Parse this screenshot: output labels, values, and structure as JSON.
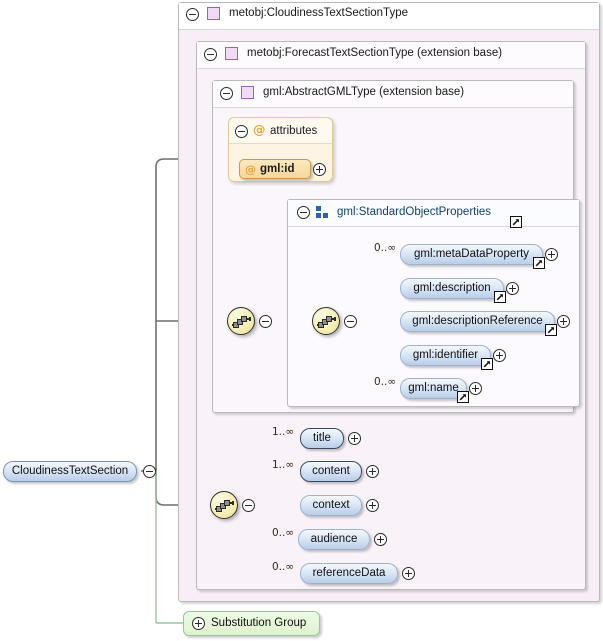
{
  "diagram": {
    "root_element": {
      "label": "CloudinessTextSection"
    },
    "substitution_group": {
      "label": "Substitution Group",
      "icon": "plus-icon"
    },
    "type_boxes": [
      {
        "label": "metobj:CloudinessTextSectionType",
        "icon": "type-icon",
        "toggle": "minus-icon"
      },
      {
        "label": "metobj:ForecastTextSectionType (extension base)",
        "icon": "type-icon",
        "toggle": "minus-icon"
      },
      {
        "label": "gml:AbstractGMLType (extension base)",
        "icon": "type-icon",
        "toggle": "minus-icon"
      }
    ],
    "attributes_box": {
      "label": "attributes",
      "icon": "at-icon",
      "toggle": "minus-icon",
      "items": [
        {
          "label": "gml:id",
          "icon": "at-icon",
          "toggle": "plus-icon",
          "has_external_link": false
        }
      ]
    },
    "group_box": {
      "label": "gml:StandardObjectProperties",
      "icon": "group-icon",
      "toggle": "minus-icon",
      "has_external_link": true,
      "compositor": "sequence",
      "elements": [
        {
          "label": "gml:metaDataProperty",
          "cardinality": "0..∞",
          "required": false,
          "toggle": "plus-icon",
          "has_external_link": true
        },
        {
          "label": "gml:description",
          "cardinality": "",
          "required": false,
          "toggle": "plus-icon",
          "has_external_link": true
        },
        {
          "label": "gml:descriptionReference",
          "cardinality": "",
          "required": false,
          "toggle": "plus-icon",
          "has_external_link": true
        },
        {
          "label": "gml:identifier",
          "cardinality": "",
          "required": false,
          "toggle": "plus-icon",
          "has_external_link": true
        },
        {
          "label": "gml:name",
          "cardinality": "0..∞",
          "required": false,
          "toggle": "plus-icon",
          "has_external_link": true
        }
      ]
    },
    "forecast_sequence": {
      "compositor": "sequence",
      "elements": [
        {
          "label": "title",
          "cardinality": "1..∞",
          "required": true,
          "toggle": "plus-icon",
          "has_external_link": false
        },
        {
          "label": "content",
          "cardinality": "1..∞",
          "required": true,
          "toggle": "plus-icon",
          "has_external_link": false
        },
        {
          "label": "context",
          "cardinality": "",
          "required": false,
          "toggle": "plus-icon",
          "has_external_link": false
        },
        {
          "label": "audience",
          "cardinality": "0..∞",
          "required": false,
          "toggle": "plus-icon",
          "has_external_link": false
        },
        {
          "label": "referenceData",
          "cardinality": "0..∞",
          "required": false,
          "toggle": "plus-icon",
          "has_external_link": false
        }
      ]
    },
    "colors": {
      "type_icon_border": "#a060b8",
      "type_icon_fill": "#efdcf4",
      "group_icon": "#2a62ab",
      "attribute_accent": "#e8a33d",
      "element_fill": "#b9cde9",
      "sequence_fill": "#f6efb8",
      "substitution_fill": "#ddf3cd",
      "connector": "#6f6f6f"
    }
  }
}
